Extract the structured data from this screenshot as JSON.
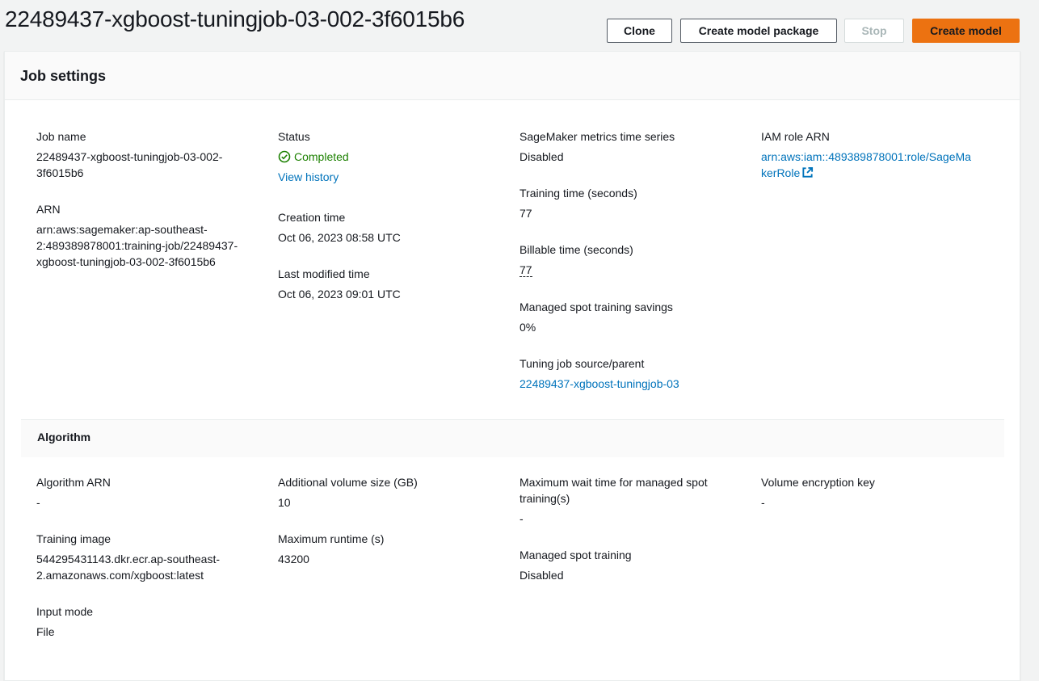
{
  "title": "22489437-xgboost-tuningjob-03-002-3f6015b6",
  "toolbar": {
    "clone": "Clone",
    "create_model_package": "Create model package",
    "stop": "Stop",
    "create_model": "Create model"
  },
  "job_settings": {
    "heading": "Job settings",
    "job_name": {
      "label": "Job name",
      "line1": "22489437-xgboost-tuningjob-03-002-",
      "line2": "3f6015b6"
    },
    "arn": {
      "label": "ARN",
      "line1": "arn:aws:sagemaker:ap-southeast-",
      "line2": "2:489389878001:training-job/22489437-",
      "line3": "xgboost-tuningjob-03-002-3f6015b6"
    },
    "status": {
      "label": "Status",
      "value": "Completed",
      "history_link": "View history"
    },
    "creation_time": {
      "label": "Creation time",
      "value": "Oct 06, 2023 08:58 UTC"
    },
    "last_modified": {
      "label": "Last modified time",
      "value": "Oct 06, 2023 09:01 UTC"
    },
    "metrics": {
      "label": "SageMaker metrics time series",
      "value": "Disabled"
    },
    "training_time": {
      "label": "Training time (seconds)",
      "value": "77"
    },
    "billable_time": {
      "label": "Billable time (seconds)",
      "value": "77"
    },
    "spot_savings": {
      "label": "Managed spot training savings",
      "value": "0%"
    },
    "tuning_parent": {
      "label": "Tuning job source/parent",
      "value": "22489437-xgboost-tuningjob-03"
    },
    "iam_role": {
      "label": "IAM role ARN",
      "line1": "arn:aws:iam::489389878001:role/SageMa",
      "line2": "kerRole"
    }
  },
  "algorithm": {
    "heading": "Algorithm",
    "algorithm_arn": {
      "label": "Algorithm ARN",
      "value": "-"
    },
    "training_image": {
      "label": "Training image",
      "line1": "544295431143.dkr.ecr.ap-southeast-",
      "line2": "2.amazonaws.com/xgboost:latest"
    },
    "input_mode": {
      "label": "Input mode",
      "value": "File"
    },
    "volume_size": {
      "label": "Additional volume size (GB)",
      "value": "10"
    },
    "max_runtime": {
      "label": "Maximum runtime (s)",
      "value": "43200"
    },
    "max_wait": {
      "label_line1": "Maximum wait time for managed spot",
      "label_line2": "training(s)",
      "value": "-"
    },
    "managed_spot": {
      "label": "Managed spot training",
      "value": "Disabled"
    },
    "encryption_key": {
      "label": "Volume encryption key",
      "value": "-"
    }
  },
  "colors": {
    "accent": "#ec7211",
    "link": "#0073bb",
    "success": "#1d8102"
  },
  "icons": {
    "status": "check-circle-icon",
    "external": "external-link-icon"
  }
}
